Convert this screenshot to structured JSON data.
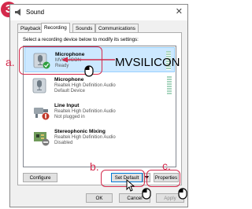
{
  "step_number": "3",
  "window": {
    "title": "Sound",
    "close_glyph": "✕"
  },
  "tabs": [
    {
      "label": "Playback"
    },
    {
      "label": "Recording",
      "active": true
    },
    {
      "label": "Sounds"
    },
    {
      "label": "Communications"
    }
  ],
  "instruction": "Select a recording device below to modify its settings:",
  "devices": [
    {
      "name": "Microphone",
      "line1": "MVSILICON",
      "line2": "Ready",
      "icon": "microphone-icon",
      "status": "default-check",
      "selected": true
    },
    {
      "name": "Microphone",
      "line1": "Realtek High Definition Audio",
      "line2": "Default Device",
      "icon": "microphone-icon",
      "status": "none",
      "selected": false
    },
    {
      "name": "Line Input",
      "line1": "Realtek High Definition Audio",
      "line2": "Not plugged in",
      "icon": "line-input-icon",
      "status": "unplugged",
      "selected": false
    },
    {
      "name": "Stereophonic Mixing",
      "line1": "Realtek High Definition Audio",
      "line2": "Disabled",
      "icon": "circuit-board-icon",
      "status": "disabled",
      "selected": false
    }
  ],
  "buttons": {
    "configure": "Configure",
    "set_default": "Set Default",
    "properties": "Properties",
    "ok": "OK",
    "cancel": "Cancel",
    "apply": "Apply"
  },
  "annotations": {
    "a": "a.",
    "b": "b.",
    "c": "c.",
    "callout": "MVSILICON"
  },
  "colors": {
    "annotation_red": "#d42a4c",
    "selection": "#cce8ff"
  }
}
